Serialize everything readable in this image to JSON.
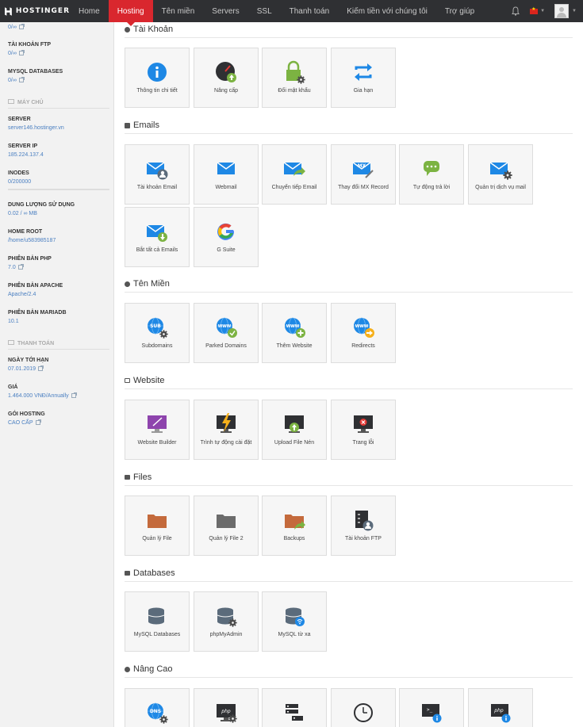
{
  "brand": "HOSTINGER",
  "nav": [
    "Home",
    "Hosting",
    "Tên miền",
    "Servers",
    "SSL",
    "Thanh toán",
    "Kiếm tiền với chúng tôi",
    "Trợ giúp"
  ],
  "nav_active": 1,
  "sidebar": {
    "top_value": "0/∞",
    "ftp_label": "TÀI KHOẢN FTP",
    "ftp_value": "0/∞",
    "mysql_label": "MYSQL DATABASES",
    "mysql_value": "0/∞",
    "section_server": "MÁY CHỦ",
    "server_label": "SERVER",
    "server_value": "server146.hostinger.vn",
    "ip_label": "SERVER IP",
    "ip_value": "185.224.137.4",
    "inodes_label": "INODES",
    "inodes_value": "0/200000",
    "inodes_fraction": 0,
    "disk_label": "DUNG LƯỢNG SỬ DỤNG",
    "disk_value": "0.02 / ∞ MB",
    "home_label": "HOME ROOT",
    "home_value": "/home/u583985187",
    "php_label": "PHIÊN BẢN PHP",
    "php_value": "7.0",
    "apache_label": "PHIÊN BẢN APACHE",
    "apache_value": "Apache/2.4",
    "mariadb_label": "PHIÊN BẢN MARIADB",
    "mariadb_value": "10.1",
    "section_billing": "THANH TOÁN",
    "due_label": "NGÀY TỚI HẠN",
    "due_value": "07.01.2019",
    "price_label": "GIÁ",
    "price_value": "1.464.000 VNĐ/Annually",
    "plan_label": "GÓI HOSTING",
    "plan_value": "CAO CẤP"
  },
  "sections": {
    "account": {
      "title": "Tài Khoản",
      "tiles": [
        "Thông tin chi tiết",
        "Nâng cấp",
        "Đổi mật khẩu",
        "Gia hạn"
      ]
    },
    "emails": {
      "title": "Emails",
      "tiles": [
        "Tài khoản Email",
        "Webmail",
        "Chuyển tiếp Email",
        "Thay đổi MX Record",
        "Tự động trả lời",
        "Quản trị dịch vụ mail",
        "Bắt tất cả Emails",
        "G Suite"
      ]
    },
    "domains": {
      "title": "Tên Miền",
      "tiles": [
        "Subdomains",
        "Parked Domains",
        "Thêm Website",
        "Redirects"
      ]
    },
    "website": {
      "title": "Website",
      "tiles": [
        "Website Builder",
        "Trình tự động cài đặt",
        "Upload File Nén",
        "Trang lỗi"
      ]
    },
    "files": {
      "title": "Files",
      "tiles": [
        "Quản lý File",
        "Quản lý File 2",
        "Backups",
        "Tài khoản FTP"
      ]
    },
    "databases": {
      "title": "Databases",
      "tiles": [
        "MySQL Databases",
        "phpMyAdmin",
        "MySQL từ xa"
      ]
    },
    "advanced": {
      "title": "Nâng Cao"
    }
  },
  "icon_text": {
    "mx": "MX",
    "sub": "SUB",
    "www": "WWW",
    "dns": "DNS",
    "php": "php",
    "prompt": ">_"
  },
  "colors": {
    "nav_bg": "#2f3033",
    "active_red": "#d9272e",
    "link_blue": "#4a7fc1",
    "icon_blue": "#1e88e5",
    "green": "#7cb342"
  }
}
